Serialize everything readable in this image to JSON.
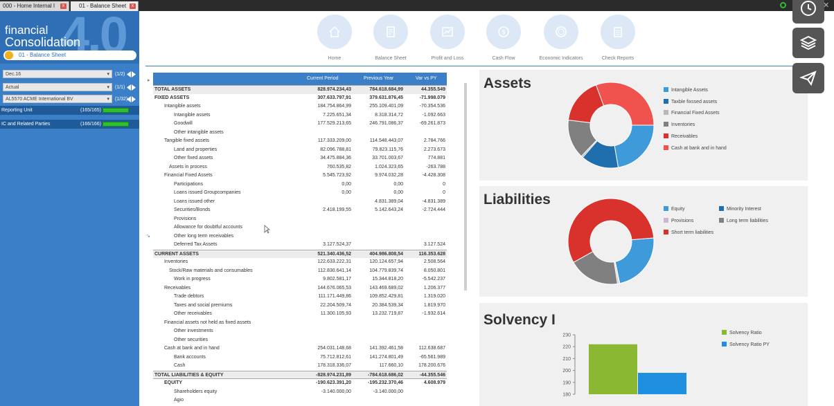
{
  "tabs": [
    {
      "label": "000 - Home Internal I",
      "close": "x"
    },
    {
      "label": "01 - Balance Sheet",
      "close": "x"
    }
  ],
  "logo": {
    "line1": "financial",
    "line2": "Consolidation",
    "version": "4.0"
  },
  "current_doc": "01 - Balance Sheet",
  "selectors": [
    {
      "value": "Dec.16",
      "count": "(1/2)"
    },
    {
      "value": "Actual",
      "count": "(1/1)"
    },
    {
      "value": "AL5570 ACME International BV",
      "count": "(1/32)"
    }
  ],
  "units": [
    {
      "label": "Reporting Unit",
      "count": "(165/165)"
    },
    {
      "label": "IC and Related Parties",
      "count": "(166/166)"
    }
  ],
  "nav": [
    {
      "label": "Home",
      "icon": "home-icon"
    },
    {
      "label": "Balance Sheet",
      "icon": "document-icon"
    },
    {
      "label": "Profit and Loss",
      "icon": "chart-icon"
    },
    {
      "label": "Cash Flow",
      "icon": "cashflow-icon"
    },
    {
      "label": "Economic Indicators",
      "icon": "coin-icon"
    },
    {
      "label": "Check Reports",
      "icon": "clipboard-icon"
    }
  ],
  "table": {
    "headers": [
      "Current Period",
      "Previous Year",
      "Var vs PY"
    ],
    "rows": [
      {
        "label": "TOTAL ASSETS",
        "indent": 0,
        "cp": "828.974.234,43",
        "py": "784.618.684,99",
        "var": "44.355.549",
        "style": "hl"
      },
      {
        "label": "FIXED ASSETS",
        "indent": 0,
        "cp": "307.633.797,91",
        "py": "379.631.876,45",
        "var": "-71.998.079",
        "style": "bold"
      },
      {
        "label": "Intangible assets",
        "indent": 1,
        "cp": "184.754.864,99",
        "py": "255.109.401,09",
        "var": "-70.354.536"
      },
      {
        "label": "Intangible assets",
        "indent": 2,
        "cp": "7.225.651,34",
        "py": "8.318.314,72",
        "var": "-1.092.663"
      },
      {
        "label": "Goodwill",
        "indent": 2,
        "cp": "177.529.213,65",
        "py": "246.791.086,37",
        "var": "-69.261.873"
      },
      {
        "label": "Other intangible assets",
        "indent": 2,
        "cp": "",
        "py": "",
        "var": ""
      },
      {
        "label": "Tangible fixed assets",
        "indent": 1,
        "cp": "117.333.209,00",
        "py": "114.548.443,07",
        "var": "2.784.766"
      },
      {
        "label": "Land and properties",
        "indent": 2,
        "cp": "82.096.788,81",
        "py": "79.823.115,76",
        "var": "2.273.673"
      },
      {
        "label": "Other fixed assets",
        "indent": 2,
        "cp": "34.475.884,36",
        "py": "33.701.003,67",
        "var": "774.881"
      },
      {
        "label": "Assets in process",
        "indent": 1.5,
        "cp": "760.535,82",
        "py": "1.024.323,65",
        "var": "-263.788"
      },
      {
        "label": "Financial Fixed Assets",
        "indent": 1,
        "cp": "5.545.723,92",
        "py": "9.974.032,28",
        "var": "-4.428.308"
      },
      {
        "label": "Participations",
        "indent": 2,
        "cp": "0,00",
        "py": "0,00",
        "var": "0"
      },
      {
        "label": "Loans issued Groupcompanies",
        "indent": 2,
        "cp": "0,00",
        "py": "0,00",
        "var": "0"
      },
      {
        "label": "Loans issued other",
        "indent": 2,
        "cp": "",
        "py": "4.831.389,04",
        "var": "-4.831.389"
      },
      {
        "label": "Securities/Bonds",
        "indent": 2,
        "cp": "2.418.199,55",
        "py": "5.142.643,24",
        "var": "-2.724.444"
      },
      {
        "label": "Provisions",
        "indent": 2,
        "cp": "",
        "py": "",
        "var": ""
      },
      {
        "label": "Allowance for doubtful accounts",
        "indent": 2,
        "cp": "",
        "py": "",
        "var": ""
      },
      {
        "label": "Other long term receivables",
        "indent": 2,
        "cp": "",
        "py": "",
        "var": ""
      },
      {
        "label": "Deferred Tax Assets",
        "indent": 2,
        "cp": "3.127.524,37",
        "py": "",
        "var": "3.127.524"
      },
      {
        "label": "CURRENT ASSETS",
        "indent": 0,
        "cp": "521.340.436,52",
        "py": "404.986.808,54",
        "var": "116.353.628",
        "style": "hl"
      },
      {
        "label": "Inventories",
        "indent": 1,
        "cp": "122.633.222,31",
        "py": "120.124.657,94",
        "var": "2.508.564"
      },
      {
        "label": "Stock/Raw materials and consumables",
        "indent": 1.5,
        "cp": "112.830.641,14",
        "py": "104.779.839,74",
        "var": "8.050.801"
      },
      {
        "label": "Work in progress",
        "indent": 2,
        "cp": "9.802.581,17",
        "py": "15.344.818,20",
        "var": "-5.542.237"
      },
      {
        "label": "Receivables",
        "indent": 1,
        "cp": "144.676.065,53",
        "py": "143.469.689,02",
        "var": "1.206.377"
      },
      {
        "label": "Trade debtors",
        "indent": 2,
        "cp": "111.171.449,86",
        "py": "109.852.429,81",
        "var": "1.319.020"
      },
      {
        "label": "Taxes and social premiums",
        "indent": 2,
        "cp": "22.204.509,74",
        "py": "20.384.539,34",
        "var": "1.819.970"
      },
      {
        "label": "Other receivables",
        "indent": 2,
        "cp": "11.300.105,93",
        "py": "13.232.719,87",
        "var": "-1.932.614"
      },
      {
        "label": "Financial assets not held as fixed assets",
        "indent": 1,
        "cp": "",
        "py": "",
        "var": ""
      },
      {
        "label": "Other investments",
        "indent": 2,
        "cp": "",
        "py": "",
        "var": ""
      },
      {
        "label": "Other securities",
        "indent": 2,
        "cp": "",
        "py": "",
        "var": ""
      },
      {
        "label": "Cash at bank and in hand",
        "indent": 1,
        "cp": "254.031.148,68",
        "py": "141.392.461,58",
        "var": "112.638.687"
      },
      {
        "label": "Bank accounts",
        "indent": 2,
        "cp": "75.712.812,61",
        "py": "141.274.801,49",
        "var": "-65.561.989"
      },
      {
        "label": "Cash",
        "indent": 2,
        "cp": "178.318.336,07",
        "py": "117.660,10",
        "var": "178.200.676"
      },
      {
        "label": "TOTAL LIABILITIES & EQUITY",
        "indent": 0,
        "cp": "-828.974.231,89",
        "py": "-784.618.686,02",
        "var": "-44.355.546",
        "style": "hl2"
      },
      {
        "label": "EQUITY",
        "indent": 1,
        "cp": "-190.623.391,20",
        "py": "-195.232.370,46",
        "var": "4.608.979",
        "style": "bold"
      },
      {
        "label": "Shareholders equity",
        "indent": 2,
        "cp": "-3.140.000,00",
        "py": "-3.140.000,00",
        "var": ""
      },
      {
        "label": "Agio",
        "indent": 2,
        "cp": "",
        "py": "",
        "var": ""
      }
    ]
  },
  "panels": {
    "assets": {
      "title": "Assets",
      "legend": [
        {
          "label": "Intangible Assets",
          "color": "#3e9ad8"
        },
        {
          "label": "Taxble fixssed assets",
          "color": "#1f6fae"
        },
        {
          "label": "Financial Fixed Assets",
          "color": "#b8b8b8"
        },
        {
          "label": "Inventories",
          "color": "#808080"
        },
        {
          "label": "Receivables",
          "color": "#d9312b"
        },
        {
          "label": "Cash at bank and in hand",
          "color": "#f0524d"
        }
      ]
    },
    "liabilities": {
      "title": "Liabilities",
      "legend": [
        {
          "label": "Equity",
          "color": "#3e9ad8"
        },
        {
          "label": "Minority Interest",
          "color": "#1f6fae"
        },
        {
          "label": "Provisions",
          "color": "#c8b8d0"
        },
        {
          "label": "Long term liabilities",
          "color": "#808080"
        },
        {
          "label": "Short term liabilities",
          "color": "#d9312b"
        }
      ]
    },
    "solvency": {
      "title": "Solvency I",
      "legend": [
        {
          "label": "Solvency Ratio",
          "color": "#8ab833"
        },
        {
          "label": "Solvency Ratio PY",
          "color": "#1f8fe0"
        }
      ]
    }
  },
  "chart_data": [
    {
      "type": "pie",
      "title": "Assets",
      "categories": [
        "Intangible Assets",
        "Taxble fixssed assets",
        "Financial Fixed Assets",
        "Inventories",
        "Receivables",
        "Cash at bank and in hand"
      ],
      "values": [
        184754865,
        117333209,
        5545724,
        122633222,
        144676066,
        254031149
      ]
    },
    {
      "type": "pie",
      "title": "Liabilities",
      "categories": [
        "Equity",
        "Minority Interest",
        "Provisions",
        "Long term liabilities",
        "Short term liabilities"
      ],
      "values": [
        190623391,
        2000000,
        5000000,
        160000000,
        471350841
      ]
    },
    {
      "type": "bar",
      "title": "Solvency I",
      "categories": [
        "Solvency Ratio",
        "Solvency Ratio PY"
      ],
      "values": [
        222,
        198
      ],
      "ylim": [
        180,
        230
      ],
      "yticks": [
        180,
        190,
        200,
        210,
        220,
        230
      ]
    }
  ]
}
